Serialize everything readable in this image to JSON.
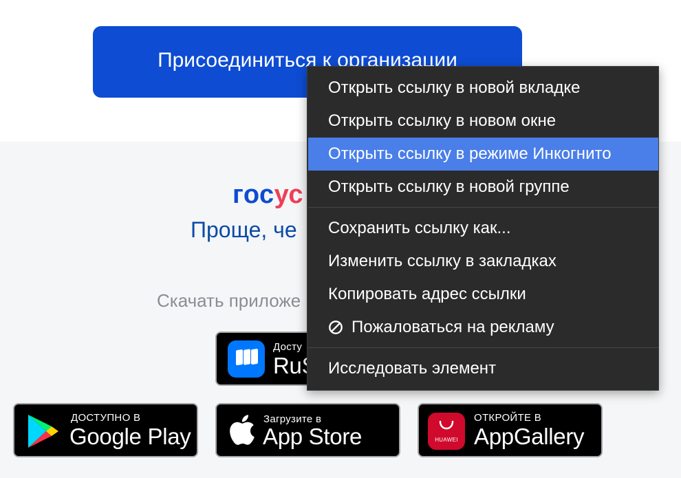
{
  "page": {
    "join_button_label": "Присоединиться к организации",
    "logo_part1": "гос",
    "logo_part2": "ус",
    "tagline": "Проще, че",
    "download_text": "Скачать приложе",
    "rustore": {
      "small": "Досту",
      "large": "RuS"
    },
    "google_play": {
      "small": "ДОСТУПНО В",
      "large": "Google Play"
    },
    "app_store": {
      "small": "Загрузите в",
      "large": "App Store"
    },
    "app_gallery": {
      "small": "ОТКРОЙТЕ В",
      "large": "AppGallery",
      "brand": "HUAWEI"
    }
  },
  "context_menu": {
    "items": [
      {
        "label": "Открыть ссылку в новой вкладке"
      },
      {
        "label": "Открыть ссылку в новом окне"
      },
      {
        "label": "Открыть ссылку в режиме Инкогнито",
        "highlighted": true
      },
      {
        "label": "Открыть ссылку в новой группе"
      },
      {
        "label": "Сохранить ссылку как..."
      },
      {
        "label": "Изменить ссылку в закладках"
      },
      {
        "label": "Копировать адрес ссылки"
      },
      {
        "label": "Пожаловаться на рекламу",
        "icon": "prohibited-icon"
      },
      {
        "label": "Исследовать элемент"
      }
    ]
  },
  "colors": {
    "primary_blue": "#0d4cd3",
    "menu_background": "#2b2b2b",
    "menu_highlight": "#4a7ee8",
    "logo_red": "#ee3f58",
    "footer_background": "#f5f6f7"
  }
}
